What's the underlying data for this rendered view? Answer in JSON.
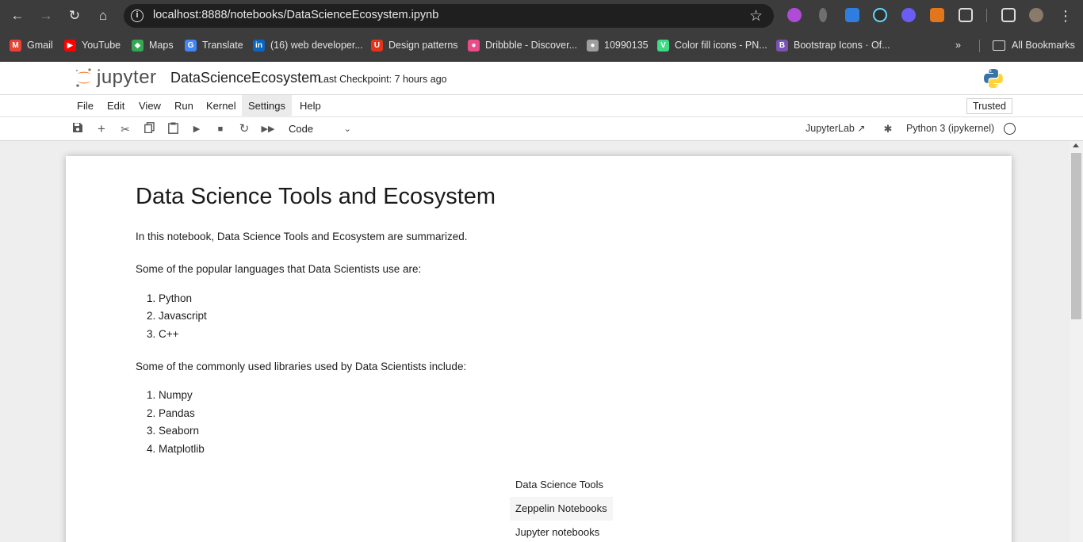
{
  "browser": {
    "url": "localhost:8888/notebooks/DataScienceEcosystem.ipynb",
    "bookmarks": [
      {
        "label": "Gmail",
        "color": "#ea4335",
        "glyph": "M"
      },
      {
        "label": "YouTube",
        "color": "#ff0000",
        "glyph": "▶"
      },
      {
        "label": "Maps",
        "color": "#34a853",
        "glyph": "◆"
      },
      {
        "label": "Translate",
        "color": "#4285f4",
        "glyph": "G"
      },
      {
        "label": "(16) web developer...",
        "color": "#0a66c2",
        "glyph": "in"
      },
      {
        "label": "Design patterns",
        "color": "#e4321b",
        "glyph": "U"
      },
      {
        "label": "Dribbble - Discover...",
        "color": "#ea4c89",
        "glyph": "●"
      },
      {
        "label": "10990135",
        "color": "#9e9e9e",
        "glyph": "●"
      },
      {
        "label": "Color fill icons - PN...",
        "color": "#3ddc84",
        "glyph": "V"
      },
      {
        "label": "Bootstrap Icons · Of...",
        "color": "#7952b3",
        "glyph": "B"
      }
    ],
    "all_bookmarks": "All Bookmarks"
  },
  "header": {
    "logo_text": "jupyter",
    "notebook_title": "DataScienceEcosystem",
    "checkpoint": "Last Checkpoint: 7 hours ago"
  },
  "menu": {
    "items": [
      "File",
      "Edit",
      "View",
      "Run",
      "Kernel",
      "Settings",
      "Help"
    ],
    "trusted": "Trusted"
  },
  "toolbar": {
    "cell_type": "Code",
    "jupyterlab": "JupyterLab",
    "kernel": "Python 3 (ipykernel)"
  },
  "notebook": {
    "heading": "Data Science Tools and Ecosystem",
    "intro": "In this notebook, Data Science Tools and Ecosystem are summarized.",
    "languages_intro": "Some of the popular languages that Data Scientists use are:",
    "languages": [
      "1. Python",
      "2. Javascript",
      "3. C++"
    ],
    "libraries_intro": "Some of the commonly used libraries used by Data Scientists include:",
    "libraries": [
      "1. Numpy",
      "2. Pandas",
      "3. Seaborn",
      "4. Matplotlib"
    ],
    "table": {
      "header": "Data Science Tools",
      "rows": [
        "Zeppelin Notebooks",
        "Jupyter notebooks"
      ]
    }
  }
}
